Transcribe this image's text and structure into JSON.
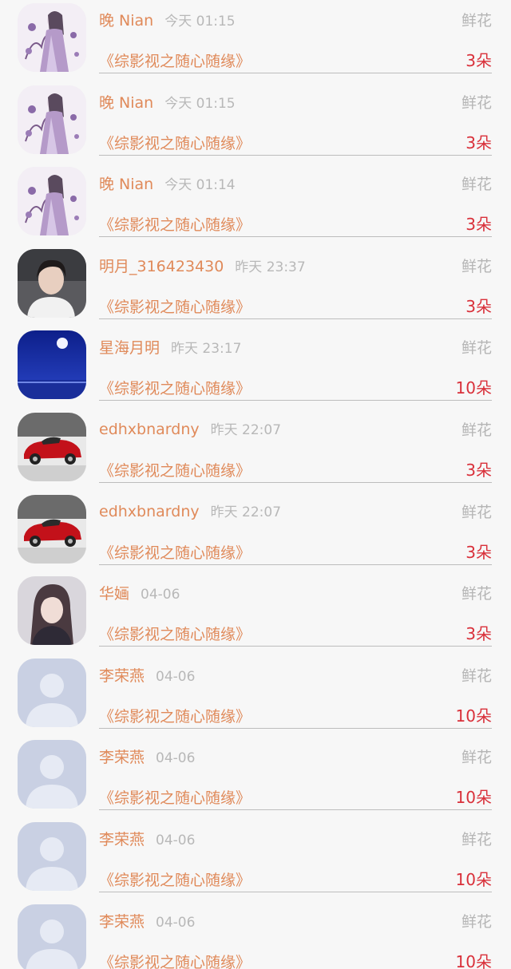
{
  "gift_items": [
    {
      "user": "晚 Nian",
      "time": "今天 01:15",
      "gift": "鲜花",
      "book": "《综影视之随心随缘》",
      "count": "3朵",
      "avatar": "illustration-avatar"
    },
    {
      "user": "晚 Nian",
      "time": "今天 01:15",
      "gift": "鲜花",
      "book": "《综影视之随心随缘》",
      "count": "3朵",
      "avatar": "illustration-avatar"
    },
    {
      "user": "晚 Nian",
      "time": "今天 01:14",
      "gift": "鲜花",
      "book": "《综影视之随心随缘》",
      "count": "3朵",
      "avatar": "illustration-avatar"
    },
    {
      "user": "明月_316423430",
      "time": "昨天 23:37",
      "gift": "鲜花",
      "book": "《综影视之随心随缘》",
      "count": "3朵",
      "avatar": "portrait-avatar"
    },
    {
      "user": "星海月明",
      "time": "昨天 23:17",
      "gift": "鲜花",
      "book": "《综影视之随心随缘》",
      "count": "10朵",
      "avatar": "night-moon-avatar"
    },
    {
      "user": "edhxbnardny",
      "time": "昨天 22:07",
      "gift": "鲜花",
      "book": "《综影视之随心随缘》",
      "count": "3朵",
      "avatar": "red-car-avatar"
    },
    {
      "user": "edhxbnardny",
      "time": "昨天 22:07",
      "gift": "鲜花",
      "book": "《综影视之随心随缘》",
      "count": "3朵",
      "avatar": "red-car-avatar"
    },
    {
      "user": "华婳",
      "time": "04-06",
      "gift": "鲜花",
      "book": "《综影视之随心随缘》",
      "count": "3朵",
      "avatar": "girl-photo-avatar"
    },
    {
      "user": "李荣燕",
      "time": "04-06",
      "gift": "鲜花",
      "book": "《综影视之随心随缘》",
      "count": "10朵",
      "avatar": "default-user-avatar"
    },
    {
      "user": "李荣燕",
      "time": "04-06",
      "gift": "鲜花",
      "book": "《综影视之随心随缘》",
      "count": "10朵",
      "avatar": "default-user-avatar"
    },
    {
      "user": "李荣燕",
      "time": "04-06",
      "gift": "鲜花",
      "book": "《综影视之随心随缘》",
      "count": "10朵",
      "avatar": "default-user-avatar"
    },
    {
      "user": "李荣燕",
      "time": "04-06",
      "gift": "鲜花",
      "book": "《综影视之随心随缘》",
      "count": "10朵",
      "avatar": "default-user-avatar"
    }
  ],
  "colors": {
    "name": "#e08a5a",
    "time": "#b8b8b8",
    "gift": "#b5b5b5",
    "count": "#d9303a",
    "background": "#f7f7f7"
  }
}
